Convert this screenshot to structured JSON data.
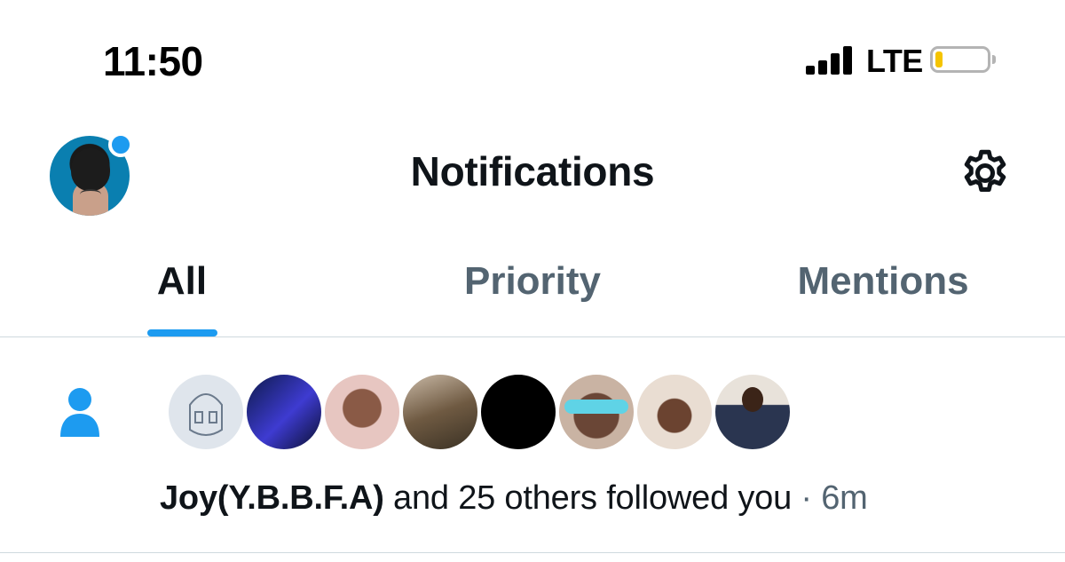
{
  "status_bar": {
    "time": "11:50",
    "network": "LTE",
    "battery_level": 0.15,
    "battery_color": "#f5c400",
    "signal_icon": "cellular-signal-icon"
  },
  "header": {
    "title": "Notifications",
    "avatar_icon": "profile-avatar",
    "settings_icon": "gear-icon",
    "unread_dot_color": "#1d9bf0"
  },
  "tabs": [
    {
      "label": "All",
      "active": true
    },
    {
      "label": "Priority",
      "active": false
    },
    {
      "label": "Mentions",
      "active": false
    }
  ],
  "notification": {
    "icon": "person-icon",
    "accent": "#1d9bf0",
    "avatar_count": 8,
    "name": "Joy(Y.B.B.F.A)",
    "text": " and 25 others followed you",
    "separator": " · ",
    "time": "6m"
  }
}
